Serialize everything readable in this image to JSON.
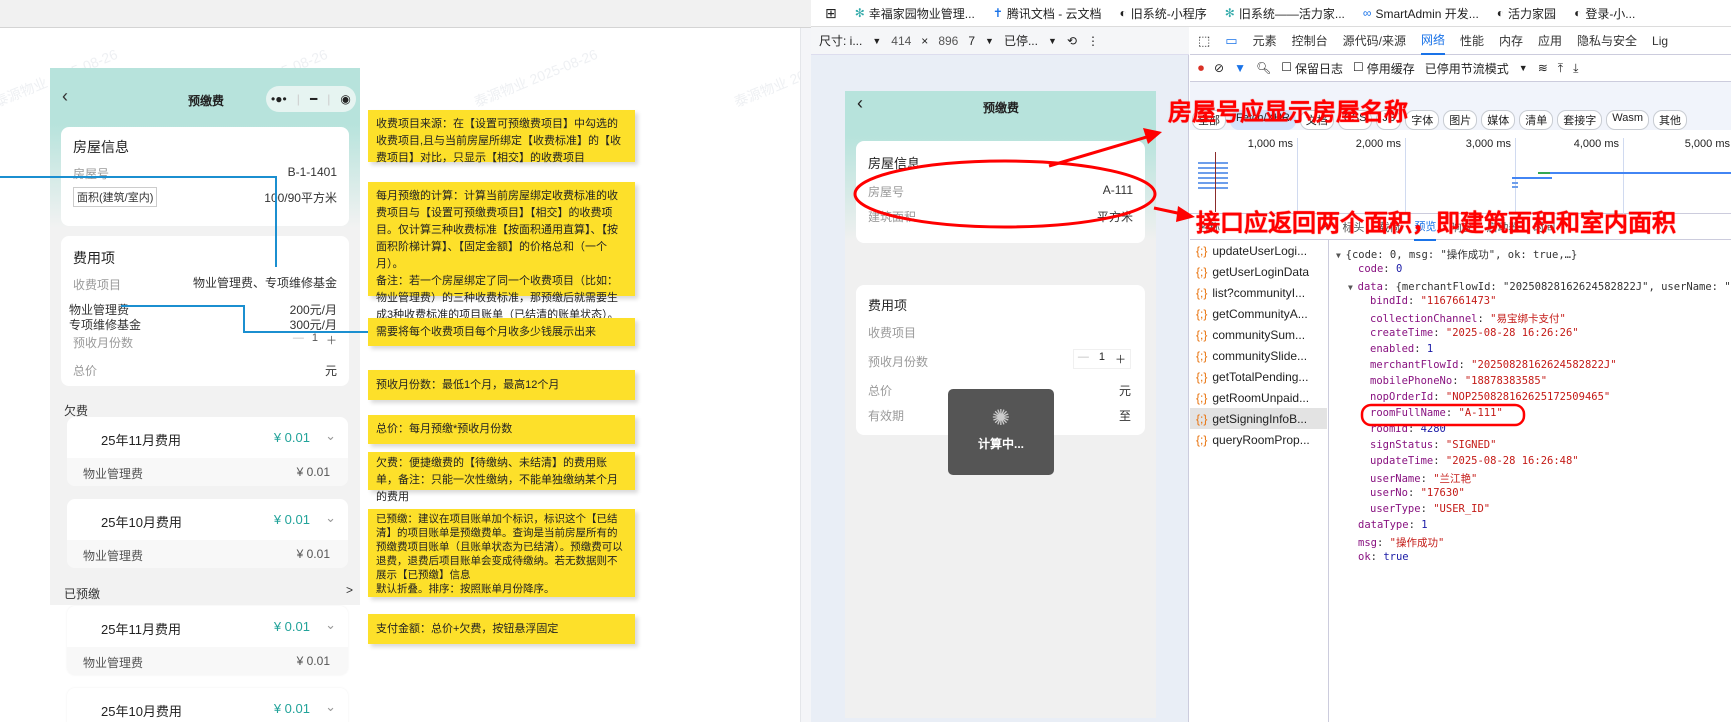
{
  "watermark": "泰源物业 2025-08-26",
  "design": {
    "title": "预缴费",
    "house_card": {
      "title": "房屋信息",
      "room_label": "房屋号",
      "room_value": "B-1-1401",
      "area_label": "面积(建筑/室内)",
      "area_value": "100/90平方米"
    },
    "fee_card": {
      "title": "费用项",
      "items_label": "收费项目",
      "items_value": "物业管理费、专项维修基金",
      "item1_label": "物业管理费",
      "item1_value": "200元/月",
      "item2_label": "专项维修基金",
      "item2_value": "300元/月",
      "months_label": "预收月份数",
      "months_value": "1",
      "total_label": "总价",
      "total_value": "元"
    },
    "arrears_label": "欠费",
    "prepaid_label": "已预缴",
    "prepaid_arrow": ">",
    "bills": [
      {
        "title": "25年11月费用",
        "amount": "¥ 0.01",
        "sub_label": "物业管理费",
        "sub_amount": "¥ 0.01"
      },
      {
        "title": "25年10月费用",
        "amount": "¥ 0.01",
        "sub_label": "物业管理费",
        "sub_amount": "¥ 0.01"
      },
      {
        "title": "25年11月费用",
        "amount": "¥ 0.01",
        "sub_label": "物业管理费",
        "sub_amount": "¥ 0.01"
      },
      {
        "title": "25年10月费用",
        "amount": "¥ 0.01"
      }
    ],
    "notes": [
      "收费项目来源：在【设置可预缴费项目】中勾选的收费项目,且与当前房屋所绑定【收费标准】的【收费项目】对比，只显示【相交】的收费项目",
      "每月预缴的计算：计算当前房屋绑定收费标准的收费项目与【设置可预缴费项目】【相交】的收费项目。仅计算三种收费标准【按面积通用直算】、【按面积阶梯计算】、【固定金额】的价格总和（一个月）。\n备注：若一个房屋绑定了同一个收费项目（比如：物业管理费）的三种收费标准，那预缴后就需要生成3种收费标准的项目账单（已结清的账单状态）。",
      "需要将每个收费项目每个月收多少钱展示出来",
      "预收月份数：最低1个月，最高12个月",
      "总价：每月预缴*预收月份数",
      "欠费：便捷缴费的【待缴纳、未结清】的费用账单，备注：只能一次性缴纳，不能单独缴纳某个月的费用",
      "已预缴：建议在项目账单加个标识，标识这个【已结清】的项目账单是预缴费单。查询是当前房屋所有的预缴费项目账单（且账单状态为已结清）。预缴费可以退费，退费后项目账单会变成待缴纳。若无数据则不展示【已预缴】信息\n默认折叠。排序：按照账单月份降序。",
      "支付金额：总价+欠费，按钮悬浮固定"
    ]
  },
  "browser": {
    "bookmarks": [
      "幸福家园物业管理...",
      "腾讯文档 - 云文档",
      "旧系统-小程序",
      "旧系统——活力家...",
      "SmartAdmin 开发...",
      "活力家园",
      "登录-小..."
    ]
  },
  "device_toolbar": {
    "device": "尺寸: i...",
    "width": "414",
    "x": "×",
    "height": "896",
    "zoom": "7",
    "throttle": "已停..."
  },
  "devtools": {
    "tabs": [
      "元素",
      "控制台",
      "源代码/来源",
      "网络",
      "性能",
      "内存",
      "应用",
      "隐私与安全",
      "Lig"
    ],
    "active_tab": "网络",
    "preserve_log": "保留日志",
    "disable_cache": "停用缓存",
    "throttling": "已停用节流模式",
    "filter_chips": [
      "全部",
      "Fetch/XHR",
      "文档",
      "CSS",
      "JS",
      "字体",
      "图片",
      "媒体",
      "清单",
      "套接字",
      "Wasm",
      "其他"
    ],
    "timeline_ticks": [
      "1,000 ms",
      "2,000 ms",
      "3,000 ms",
      "4,000 ms",
      "5,000 ms"
    ],
    "detail_tabs": [
      "名称",
      "×",
      "标头",
      "载荷",
      "预览",
      "响应",
      "启动器",
      "时间"
    ],
    "requests": [
      "updateUserLogi...",
      "getUserLoginData",
      "list?communityI...",
      "getCommunityA...",
      "communitySum...",
      "communitySlide...",
      "getTotalPending...",
      "getRoomUnpaid...",
      "getSigningInfoB...",
      "queryRoomProp..."
    ],
    "selected_request": "getSigningInfoB...",
    "json_lines": [
      {
        "indent": 0,
        "arrow": "▼",
        "key": "",
        "val": "{code: 0, msg: \"操作成功\", ok: true,…}",
        "type": "plain"
      },
      {
        "indent": 1,
        "key": "code",
        "val": "0",
        "type": "n"
      },
      {
        "indent": 1,
        "arrow": "▼",
        "key": "data",
        "val": "{merchantFlowId: \"20250828162624582822J\", userName: \"兰江",
        "type": "plain"
      },
      {
        "indent": 2,
        "key": "bindId",
        "val": "\"1167661473\"",
        "type": "s"
      },
      {
        "indent": 2,
        "key": "collectionChannel",
        "val": "\"易宝绑卡支付\"",
        "type": "s"
      },
      {
        "indent": 2,
        "key": "createTime",
        "val": "\"2025-08-28 16:26:26\"",
        "type": "s"
      },
      {
        "indent": 2,
        "key": "enabled",
        "val": "1",
        "type": "n"
      },
      {
        "indent": 2,
        "key": "merchantFlowId",
        "val": "\"20250828162624582822J\"",
        "type": "s"
      },
      {
        "indent": 2,
        "key": "mobilePhoneNo",
        "val": "\"18878383585\"",
        "type": "s"
      },
      {
        "indent": 2,
        "key": "nopOrderId",
        "val": "\"NOP250828162625172509465\"",
        "type": "s"
      },
      {
        "indent": 2,
        "key": "roomFullName",
        "val": "\"A-111\"",
        "type": "s"
      },
      {
        "indent": 2,
        "key": "roomId",
        "val": "4280",
        "type": "n"
      },
      {
        "indent": 2,
        "key": "signStatus",
        "val": "\"SIGNED\"",
        "type": "s"
      },
      {
        "indent": 2,
        "key": "updateTime",
        "val": "\"2025-08-28 16:26:48\"",
        "type": "s"
      },
      {
        "indent": 2,
        "key": "userName",
        "val": "\"兰江艳\"",
        "type": "s"
      },
      {
        "indent": 2,
        "key": "userNo",
        "val": "\"17630\"",
        "type": "s"
      },
      {
        "indent": 2,
        "key": "userType",
        "val": "\"USER_ID\"",
        "type": "s"
      },
      {
        "indent": 1,
        "key": "dataType",
        "val": "1",
        "type": "n"
      },
      {
        "indent": 1,
        "key": "msg",
        "val": "\"操作成功\"",
        "type": "s"
      },
      {
        "indent": 1,
        "key": "ok",
        "val": "true",
        "type": "n"
      }
    ]
  },
  "preview": {
    "title": "预缴费",
    "house_title": "房屋信息",
    "room_label": "房屋号",
    "room_value": "A-111",
    "area_label": "建筑面积",
    "area_value": "平方米",
    "fee_title": "费用项",
    "items_label": "收费项目",
    "months_label": "预收月份数",
    "months_value": "1",
    "total_label": "总价",
    "total_value": "元",
    "valid_label": "有效期",
    "valid_value": "至",
    "loading_text": "计算中..."
  },
  "annotations": {
    "room_name": "房屋号应显示房屋名称",
    "two_areas": "接口应返回两个面积，即建筑面积和室内面积"
  },
  "colors": {
    "accent": "#22a39a",
    "note": "#fde02a",
    "annotation": "#ff0000",
    "devtools_blue": "#1a73e8"
  }
}
